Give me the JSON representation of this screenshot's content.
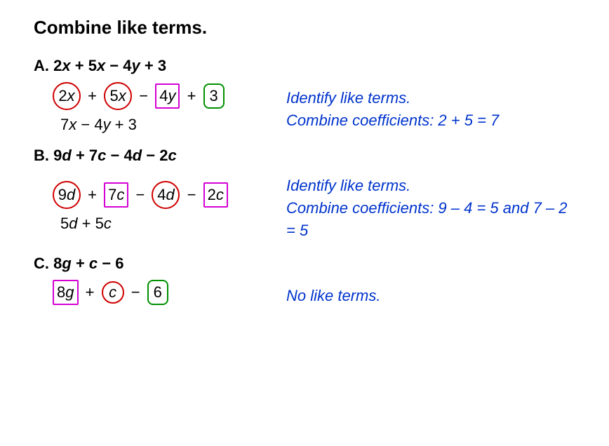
{
  "title": "Combine like terms.",
  "problems": {
    "a": {
      "label": "A.",
      "head": "2x + 5x − 4y + 3",
      "t1": "2x",
      "t2": "5x",
      "t3": "4y",
      "t4": "3",
      "op1": "+",
      "op2": "−",
      "op3": "+",
      "result": "7x − 4y + 3",
      "note1": "Identify like terms.",
      "note2": "Combine coefficients: 2 + 5 = 7"
    },
    "b": {
      "label": "B.",
      "head": "9d + 7c − 4d − 2c",
      "t1": "9d",
      "t2": "7c",
      "t3": "4d",
      "t4": "2c",
      "op1": "+",
      "op2": "−",
      "op3": "−",
      "result": "5d + 5c",
      "note1": "Identify like terms.",
      "note2": "Combine coefficients: 9 – 4 = 5 and 7 – 2 = 5"
    },
    "c": {
      "label": "C.",
      "head": "8g + c − 6",
      "t1": "8g",
      "t2": "c",
      "t3": "6",
      "op1": "+",
      "op2": "−",
      "note1": "No like terms."
    }
  }
}
